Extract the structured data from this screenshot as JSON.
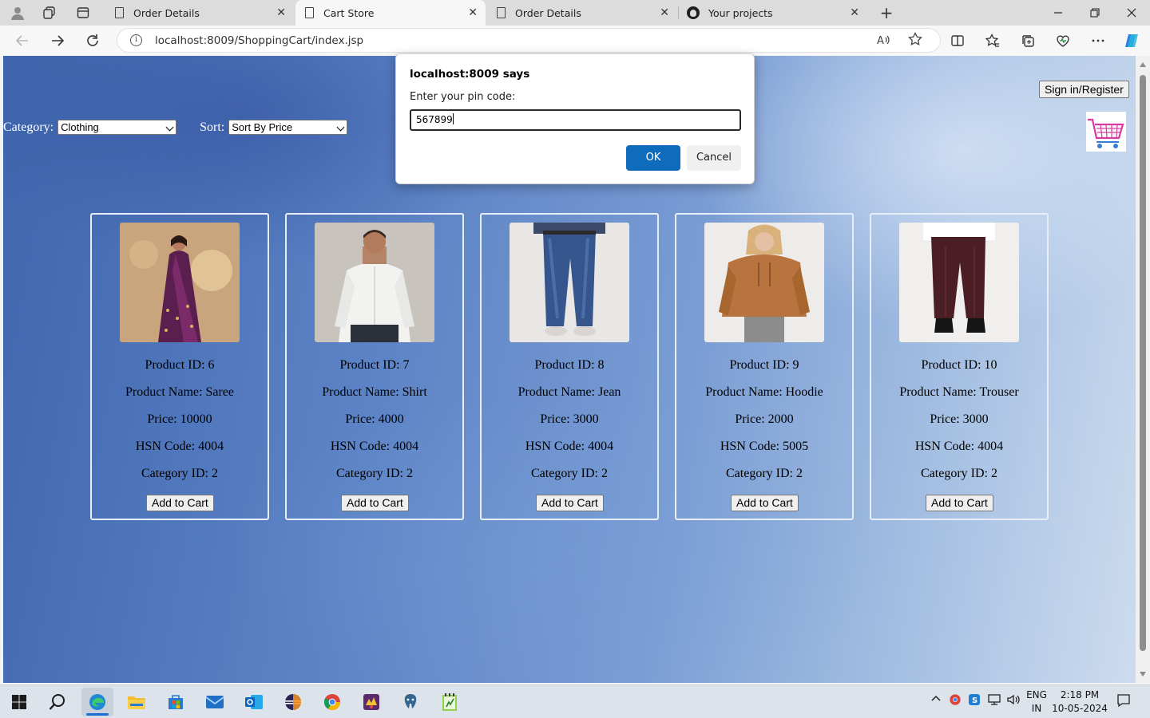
{
  "browser": {
    "tabs": [
      {
        "title": "Order Details",
        "active": false
      },
      {
        "title": "Cart Store",
        "active": true
      },
      {
        "title": "Order Details",
        "active": false
      },
      {
        "title": "Your projects",
        "active": false
      }
    ],
    "url": "localhost:8009/ShoppingCart/index.jsp",
    "close_glyph": "✕",
    "new_tab_glyph": "+"
  },
  "page": {
    "category_label": "Category:",
    "category_value": "Clothing",
    "sort_label": "Sort:",
    "sort_value": "Sort By Price",
    "signin_label": "Sign in/Register",
    "add_to_cart_label": "Add to Cart",
    "products": [
      {
        "id": "Product ID: 6",
        "name": "Product Name: Saree",
        "price": "Price: 10000",
        "hsn": "HSN Code: 4004",
        "category": "Category ID: 2",
        "image": "saree-photo"
      },
      {
        "id": "Product ID: 7",
        "name": "Product Name: Shirt",
        "price": "Price: 4000",
        "hsn": "HSN Code: 4004",
        "category": "Category ID: 2",
        "image": "shirt-photo"
      },
      {
        "id": "Product ID: 8",
        "name": "Product Name: Jean",
        "price": "Price: 3000",
        "hsn": "HSN Code: 4004",
        "category": "Category ID: 2",
        "image": "jeans-photo"
      },
      {
        "id": "Product ID: 9",
        "name": "Product Name: Hoodie",
        "price": "Price: 2000",
        "hsn": "HSN Code: 5005",
        "category": "Category ID: 2",
        "image": "hoodie-photo"
      },
      {
        "id": "Product ID: 10",
        "name": "Product Name: Trouser",
        "price": "Price: 3000",
        "hsn": "HSN Code: 4004",
        "category": "Category ID: 2",
        "image": "trouser-photo"
      }
    ]
  },
  "dialog": {
    "title": "localhost:8009 says",
    "message": "Enter your pin code:",
    "input_value": "567899",
    "ok_label": "OK",
    "cancel_label": "Cancel"
  },
  "taskbar": {
    "lang_line1": "ENG",
    "lang_line2": "IN",
    "time": "2:18 PM",
    "date": "10-05-2024"
  },
  "colors": {
    "dialog_ok": "#0f6cbd",
    "page_bg": "#5d84c6",
    "taskbar": "#dde3ea"
  }
}
